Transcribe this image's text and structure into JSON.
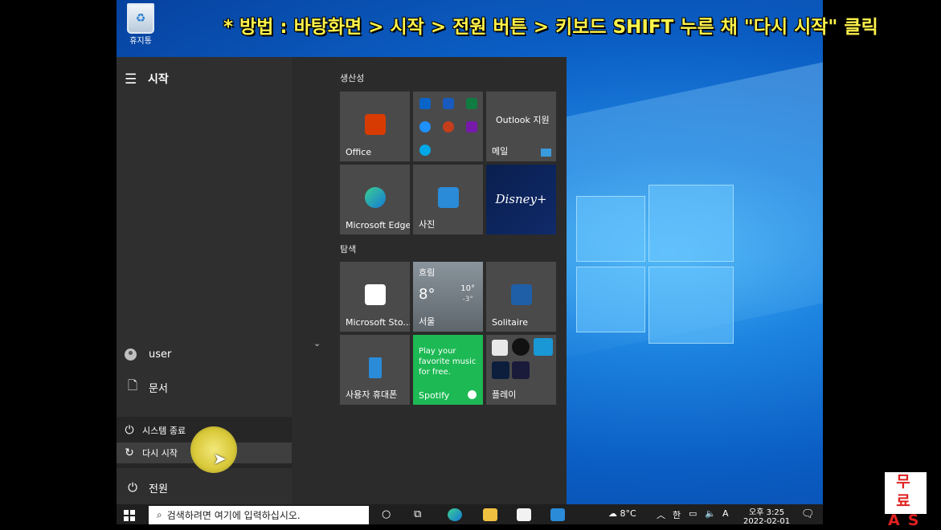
{
  "caption": "* 방법 : 바탕화면 > 시작 > 전원 버튼 > 키보드 SHIFT 누른 채 \"다시 시작\" 클릭",
  "desktop": {
    "recycle_bin_label": "휴지통"
  },
  "start_menu": {
    "title": "시작",
    "user": "user",
    "documents": "문서",
    "power_menu": {
      "shutdown": "시스템 종료",
      "restart": "다시 시작"
    },
    "power": "전원"
  },
  "groups": {
    "productivity": "생산성",
    "explore": "탐색"
  },
  "tiles": {
    "office": "Office",
    "outlook_support": "Outlook 지원",
    "mail": "메일",
    "edge": "Microsoft Edge",
    "photos": "사진",
    "disney": "Disney+",
    "store": "Microsoft Sto...",
    "weather": {
      "condition": "흐림",
      "temp": "8°",
      "high": "10°",
      "low": "-3°",
      "city": "서울"
    },
    "solitaire": "Solitaire",
    "phone": "사용자 휴대폰",
    "spotify": {
      "promo": "Play your favorite music for free.",
      "name": "Spotify"
    },
    "play": "플레이"
  },
  "taskbar": {
    "search_placeholder": "검색하려면 여기에 입력하십시오.",
    "weather": "8°C",
    "ime": "한",
    "time": "오후 3:25",
    "date": "2022-02-01",
    "lang": "A"
  },
  "badge": {
    "line1": "무료",
    "line2": "AS"
  },
  "colors": {
    "accent": "#0078d7",
    "caption": "#fff34a",
    "spotify": "#1db954",
    "badge_text": "#e02020"
  }
}
